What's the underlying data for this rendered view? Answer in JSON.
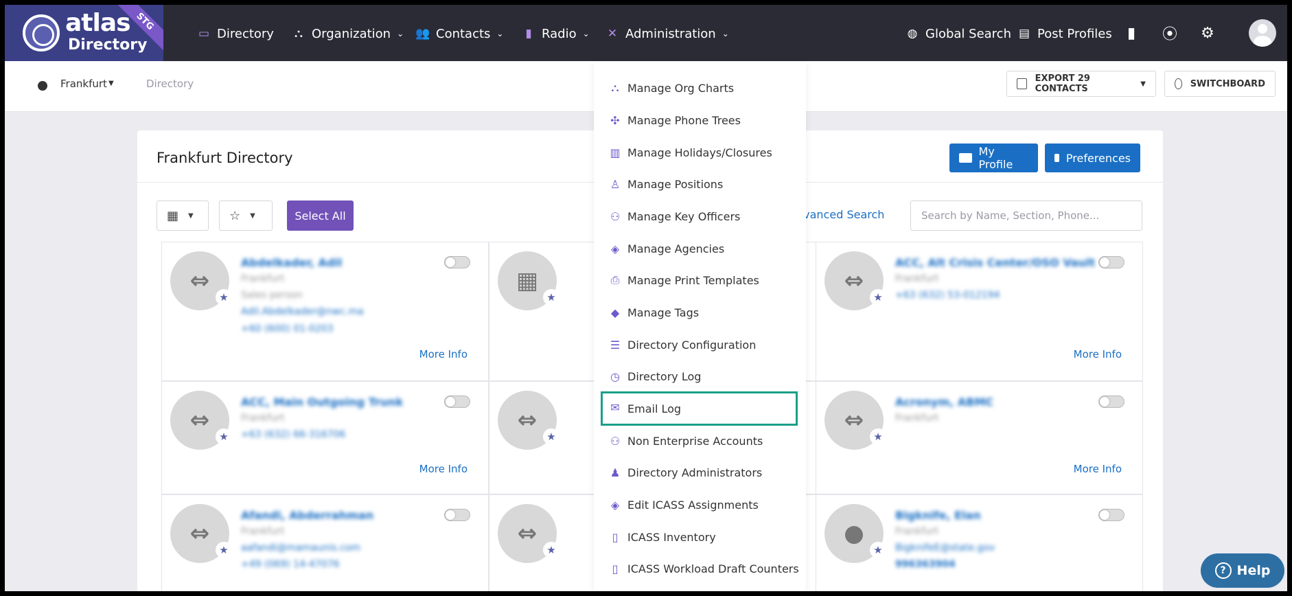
{
  "topnav": {
    "logo_main": "atlas",
    "logo_sub": "Directory",
    "logo_badge": "STG",
    "items": [
      {
        "label": "Directory",
        "icon": "directory-icon"
      },
      {
        "label": "Organization",
        "icon": "org-chart-icon"
      },
      {
        "label": "Contacts",
        "icon": "contacts-icon"
      },
      {
        "label": "Radio",
        "icon": "radio-icon"
      },
      {
        "label": "Administration",
        "icon": "tools-icon"
      }
    ],
    "global_search": "Global Search",
    "post_profiles": "Post Profiles"
  },
  "subbar": {
    "location": "Frankfurt",
    "breadcrumb": "Directory",
    "export_label": "EXPORT 29 CONTACTS",
    "switchboard_label": "SWITCHBOARD"
  },
  "card": {
    "title": "Frankfurt Directory",
    "my_profile": "My Profile",
    "preferences": "Preferences",
    "select_all": "Select All",
    "advanced_search": "dvanced Search",
    "search_placeholder": "Search by Name, Section, Phone..."
  },
  "contacts": [
    {
      "name": "Abdelkader, Adil",
      "line2": "Frankfurt",
      "line3": "Sales person",
      "line4": "Adil.Abdelkader@nwc.ma",
      "line5": "+60 (600) 01-0203",
      "more": "More Info"
    },
    {
      "name": "",
      "line2": "",
      "line3": "",
      "line4": "",
      "line5": "",
      "more": ""
    },
    {
      "name": "ACC, Alt Crisis Center/OSO Vault",
      "line2": "Frankfurt",
      "line3": "+63 (632) 53-012194",
      "line4": "",
      "line5": "",
      "more": "More Info"
    },
    {
      "name": "ACC, Main Outgoing Trunk",
      "line2": "Frankfurt",
      "line3": "+63 (632) 66-316706",
      "line4": "",
      "line5": "",
      "more": "More Info"
    },
    {
      "name": "",
      "line2": "",
      "line3": "",
      "line4": "",
      "line5": "",
      "more": ""
    },
    {
      "name": "Acronym, ABMC",
      "line2": "Frankfurt",
      "line3": "",
      "line4": "",
      "line5": "",
      "more": "More Info"
    },
    {
      "name": "Afandi, Abderrahman",
      "line2": "Frankfurt",
      "line3": "aafandi@mamaunis.com",
      "line4": "+49 (069) 14-47076",
      "line5": "",
      "more": ""
    },
    {
      "name": "",
      "line2": "",
      "line3": "",
      "line4": "",
      "line5": "",
      "more": ""
    },
    {
      "name": "Bigknife, Elan",
      "line2": "Frankfurt",
      "line3": "BigknifeE@state.gov",
      "line4": "996363904",
      "line5": "",
      "more": ""
    }
  ],
  "admin_menu": [
    {
      "label": "Manage Org Charts",
      "icon": "org-chart-icon"
    },
    {
      "label": "Manage Phone Trees",
      "icon": "phone-tree-icon"
    },
    {
      "label": "Manage Holidays/Closures",
      "icon": "building-icon"
    },
    {
      "label": "Manage Positions",
      "icon": "position-icon"
    },
    {
      "label": "Manage Key Officers",
      "icon": "key-officers-icon"
    },
    {
      "label": "Manage Agencies",
      "icon": "layers-icon"
    },
    {
      "label": "Manage Print Templates",
      "icon": "printer-icon"
    },
    {
      "label": "Manage Tags",
      "icon": "tags-icon"
    },
    {
      "label": "Directory Configuration",
      "icon": "sliders-icon"
    },
    {
      "label": "Directory Log",
      "icon": "clock-icon"
    },
    {
      "label": "Email Log",
      "icon": "envelope-icon"
    },
    {
      "label": "Non Enterprise Accounts",
      "icon": "users-icon"
    },
    {
      "label": "Directory Administrators",
      "icon": "user-shield-icon"
    },
    {
      "label": "Edit ICASS Assignments",
      "icon": "layers-icon"
    },
    {
      "label": "ICASS Inventory",
      "icon": "mobile-icon"
    },
    {
      "label": "ICASS Workload Draft Counters",
      "icon": "mobile-icon"
    }
  ],
  "help": {
    "label": "Help"
  },
  "colors": {
    "nav_bg": "#2b2b35",
    "accent_purple": "#7252b8",
    "link_blue": "#1a6fc4",
    "highlight": "#1a9f88"
  }
}
